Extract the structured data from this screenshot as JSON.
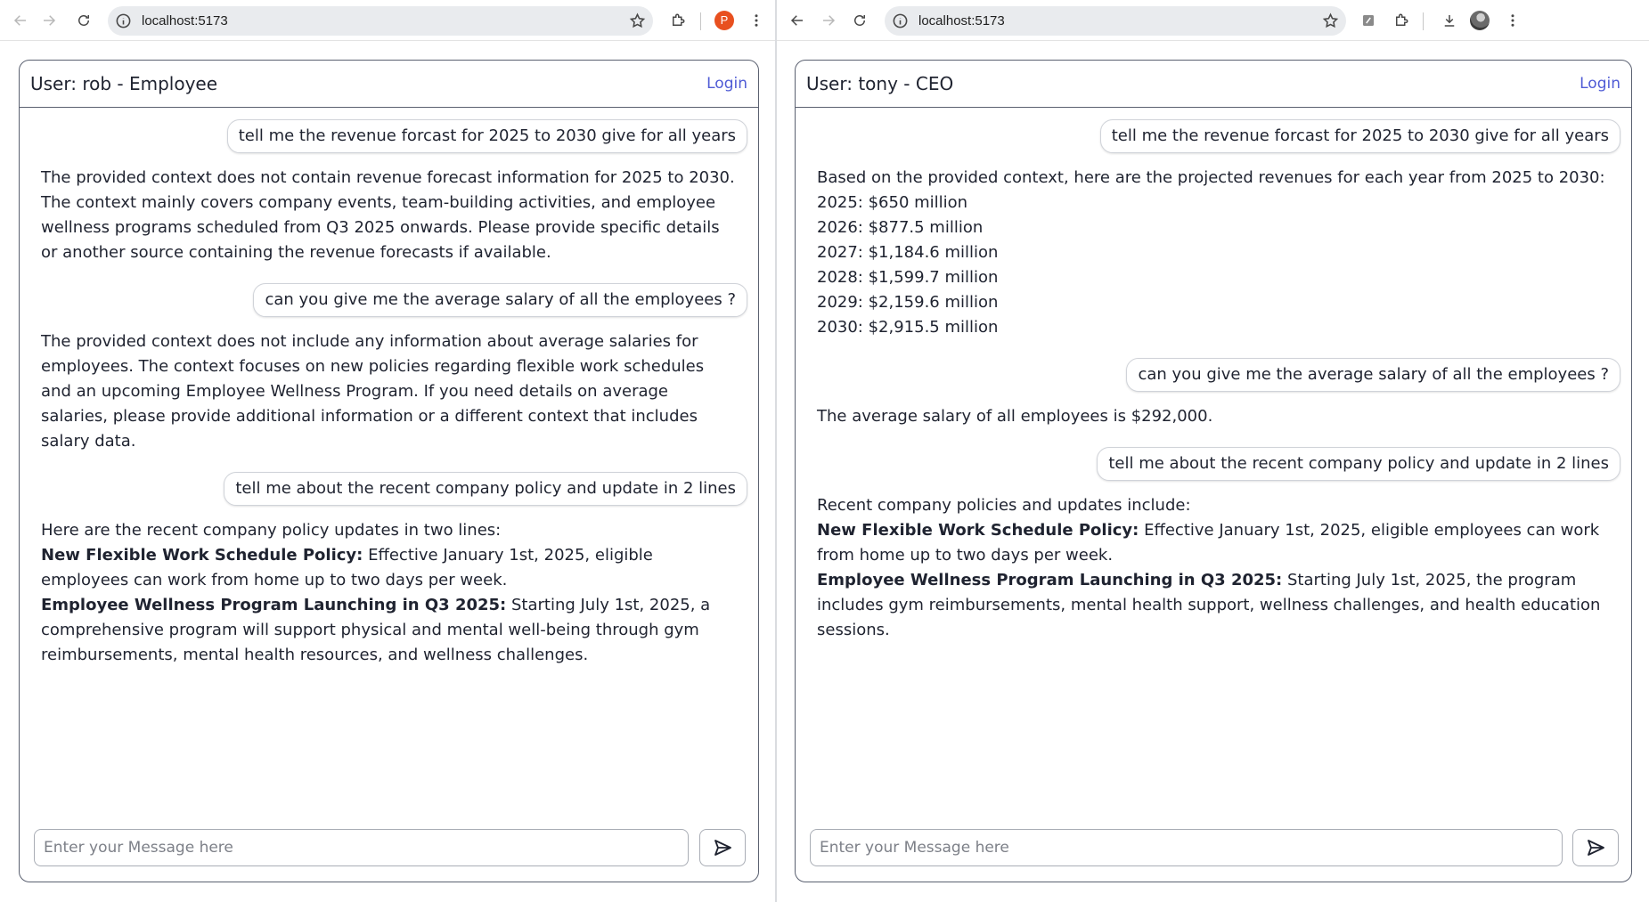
{
  "left": {
    "url": "localhost:5173",
    "profile_initial": "P",
    "chat": {
      "title": "User: rob - Employee",
      "login_label": "Login",
      "messages": [
        {
          "role": "user",
          "text": "tell me the revenue forcast for 2025 to 2030 give for all years"
        },
        {
          "role": "bot",
          "lines": [
            {
              "text": "The provided context does not contain revenue forecast information for 2025 to 2030. The context mainly covers company events, team-building activities, and employee wellness programs scheduled from Q3 2025 onwards. Please provide specific details or another source containing the revenue forecasts if available."
            }
          ]
        },
        {
          "role": "user",
          "text": "can you give me the average salary of all the employees ?"
        },
        {
          "role": "bot",
          "lines": [
            {
              "text": "The provided context does not include any information about average salaries for employees. The context focuses on new policies regarding flexible work schedules and an upcoming Employee Wellness Program. If you need details on average salaries, please provide additional information or a different context that includes salary data."
            }
          ]
        },
        {
          "role": "user",
          "text": "tell me about the recent company policy and update in 2 lines"
        },
        {
          "role": "bot",
          "lines": [
            {
              "text": "Here are the recent company policy updates in two lines:"
            },
            {
              "bold": "New Flexible Work Schedule Policy:",
              "text": " Effective January 1st, 2025, eligible employees can work from home up to two days per week."
            },
            {
              "bold": "Employee Wellness Program Launching in Q3 2025:",
              "text": " Starting July 1st, 2025, a comprehensive program will support physical and mental well-being through gym reimbursements, mental health resources, and wellness challenges."
            }
          ]
        }
      ],
      "input_placeholder": "Enter your Message here"
    }
  },
  "right": {
    "url": "localhost:5173",
    "chat": {
      "title": "User: tony - CEO",
      "login_label": "Login",
      "messages": [
        {
          "role": "user",
          "text": "tell me the revenue forcast for 2025 to 2030 give for all years"
        },
        {
          "role": "bot",
          "lines": [
            {
              "text": "Based on the provided context, here are the projected revenues for each year from 2025 to 2030:"
            },
            {
              "text": "2025: $650 million"
            },
            {
              "text": "2026: $877.5 million"
            },
            {
              "text": "2027: $1,184.6 million"
            },
            {
              "text": "2028: $1,599.7 million"
            },
            {
              "text": "2029: $2,159.6 million"
            },
            {
              "text": "2030: $2,915.5 million"
            }
          ]
        },
        {
          "role": "user",
          "text": "can you give me the average salary of all the employees ?"
        },
        {
          "role": "bot",
          "lines": [
            {
              "text": "The average salary of all employees is $292,000."
            }
          ]
        },
        {
          "role": "user",
          "text": "tell me about the recent company policy and update in 2 lines"
        },
        {
          "role": "bot",
          "lines": [
            {
              "text": "Recent company policies and updates include:"
            },
            {
              "bold": "New Flexible Work Schedule Policy:",
              "text": " Effective January 1st, 2025, eligible employees can work from home up to two days per week."
            },
            {
              "bold": "Employee Wellness Program Launching in Q3 2025:",
              "text": " Starting July 1st, 2025, the program includes gym reimbursements, mental health support, wellness challenges, and health education sessions."
            }
          ]
        }
      ],
      "input_placeholder": "Enter your Message here"
    }
  },
  "colors": {
    "link": "#4f5bd5",
    "panel_border": "#5a6070",
    "profile": "#e8501f"
  },
  "icons": {
    "back": "arrow-left-icon",
    "forward": "arrow-right-icon",
    "reload": "reload-icon",
    "site_info": "info-icon",
    "bookmark": "star-icon",
    "extensions": "puzzle-icon",
    "menu": "kebab-menu-icon",
    "downloads": "download-icon",
    "send": "send-icon"
  }
}
